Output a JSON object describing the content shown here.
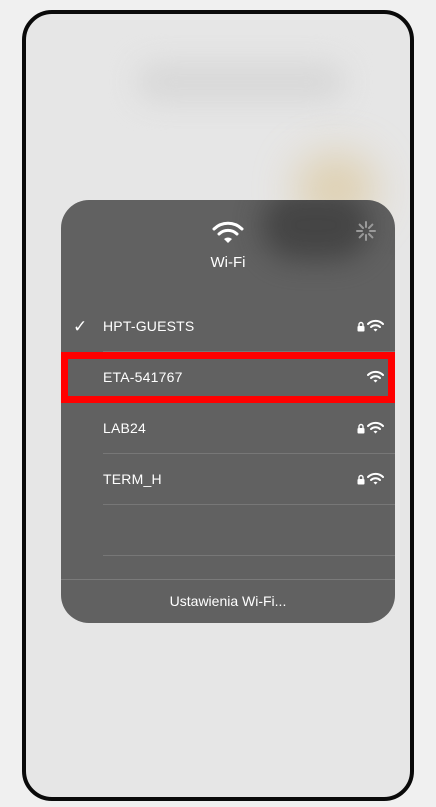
{
  "wifi_panel": {
    "title": "Wi-Fi",
    "networks": [
      {
        "name": "HPT-GUESTS",
        "connected": true,
        "secured": true
      },
      {
        "name": "ETA-541767",
        "connected": false,
        "secured": false,
        "highlighted": true
      },
      {
        "name": "LAB24",
        "connected": false,
        "secured": true
      },
      {
        "name": "TERM_H",
        "connected": false,
        "secured": true
      }
    ],
    "checkmark": "✓",
    "settings_label": "Ustawienia Wi-Fi...",
    "highlight_color": "#ff0000",
    "panel_color": "#616161"
  }
}
